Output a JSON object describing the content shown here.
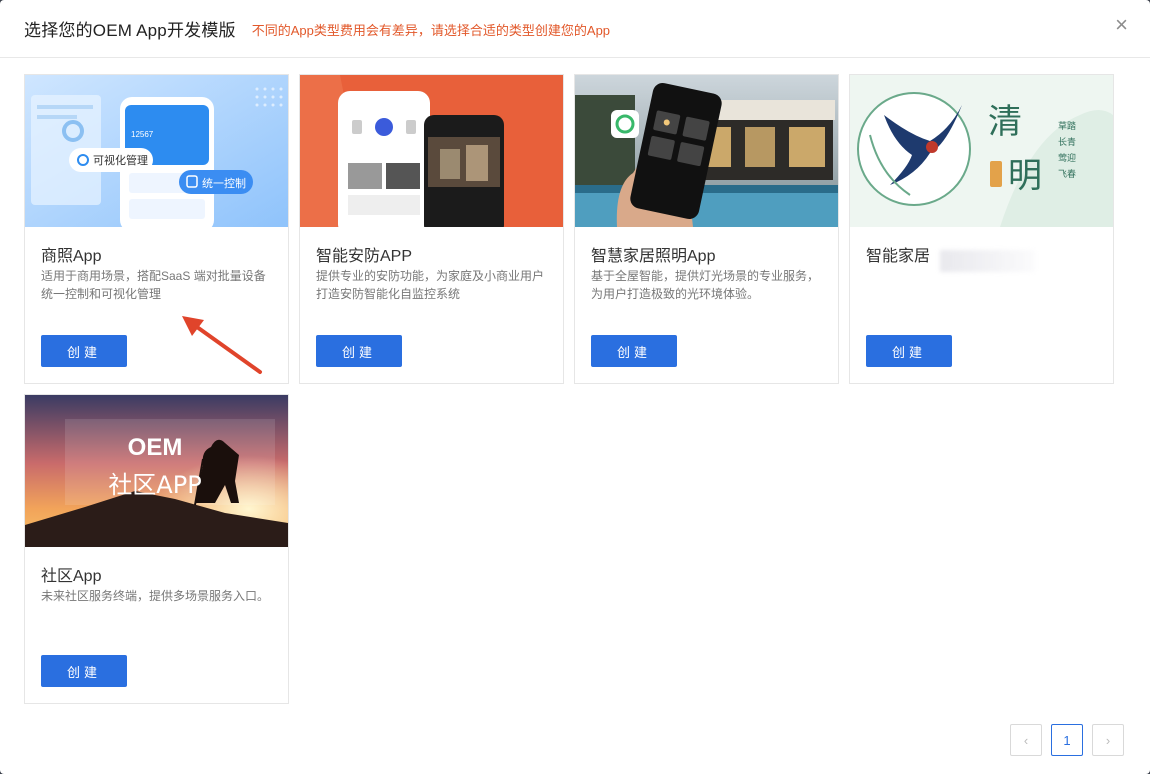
{
  "header": {
    "title": "选择您的OEM App开发模版",
    "subtitle": "不同的App类型费用会有差异，请选择合适的类型创建您的App",
    "close_glyph": "×"
  },
  "cards": [
    {
      "title": "商照App",
      "desc": "适用于商用场景，搭配SaaS 端对批量设备统一控制和可视化管理",
      "button": "创建",
      "thumb": {
        "tag1": "可视化管理",
        "tag2": "统一控制",
        "stat": "12567"
      }
    },
    {
      "title": "智能安防APP",
      "desc": "提供专业的安防功能，为家庭及小商业用户打造安防智能化自监控系统",
      "button": "创建"
    },
    {
      "title": "智慧家居照明App",
      "desc": "基于全屋智能，提供灯光场景的专业服务，为用户打造极致的光环境体验。",
      "button": "创建"
    },
    {
      "title": "智能家居",
      "desc": "",
      "button": "创建",
      "thumb": {
        "big1": "清",
        "big2": "明",
        "col1": "草踏",
        "col2": "长青",
        "col3": "莺迎",
        "col4": "飞春"
      }
    },
    {
      "title": "社区App",
      "desc": "未来社区服务终端，提供多场景服务入口。",
      "button": "创建",
      "thumb": {
        "line1": "OEM",
        "line2": "社区APP"
      }
    }
  ],
  "pagination": {
    "prev": "‹",
    "current": "1",
    "next": "›"
  },
  "colors": {
    "accent": "#2a6fe0",
    "warning": "#e2582a",
    "arrow": "#e0442b"
  }
}
